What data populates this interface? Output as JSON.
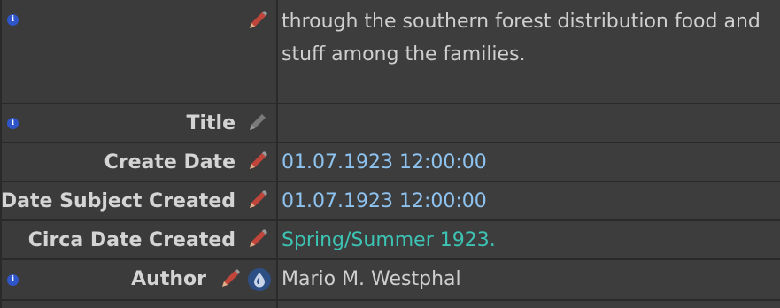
{
  "rows": {
    "description": {
      "text": "through the southern forest distribution food and stuff among the families."
    },
    "title": {
      "label": "Title",
      "value": ""
    },
    "create_date": {
      "label": "Create Date",
      "value": "01.07.1923 12:00:00"
    },
    "date_subject_created": {
      "label": "Date Subject Created",
      "value": "01.07.1923 12:00:00"
    },
    "circa_date_created": {
      "label": "Circa Date Created",
      "value": "Spring/Summer 1923."
    },
    "author": {
      "label": "Author",
      "value": "Mario M. Westphal"
    }
  },
  "icons": {
    "info": "info-icon",
    "edit": "pencil-icon",
    "source": "drop-icon"
  },
  "colors": {
    "date_value": "#8ec3ef",
    "circa_value": "#3cc3b4",
    "pencil_active": "#c0453b",
    "pencil_inactive": "#7a7a7a"
  },
  "glyphs": {
    "info": "i"
  }
}
